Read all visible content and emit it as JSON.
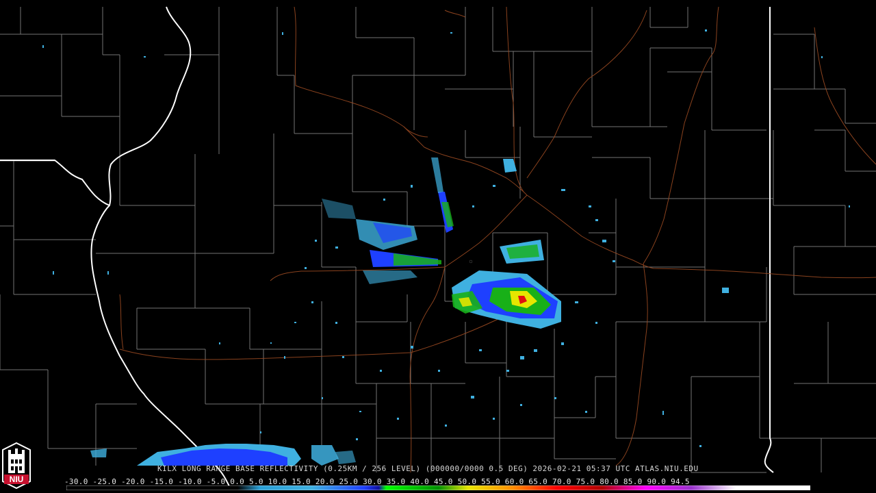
{
  "map": {
    "caption": "KILX LONG RANGE BASE REFLECTIVITY (0.25KM / 256 LEVEL) (000000/0000 0.5 DEG) 2026-02-21 05:37 UTC  ATLAS.NIU.EDU",
    "scale_labels": "-30.0 -25.0 -20.0 -15.0 -10.0 -5.0  0.0  5.0  10.0 15.0  20.0  25.0  30.0  35.0  40.0  45.0  50.0  55.0  60.0  65.0  70.0  75.0  80.0  85.0  90.0  94.5",
    "logo_text": "NIU",
    "colors": {
      "background": "#000000",
      "county_lines": "#8a8a8a",
      "state_lines": "#ffffff",
      "roads": "#a0522d",
      "echo_light": "#3fb0e0",
      "echo_blue": "#1e40ff",
      "echo_green": "#18b018",
      "echo_yellow": "#e6e600",
      "echo_red": "#e01010"
    }
  }
}
